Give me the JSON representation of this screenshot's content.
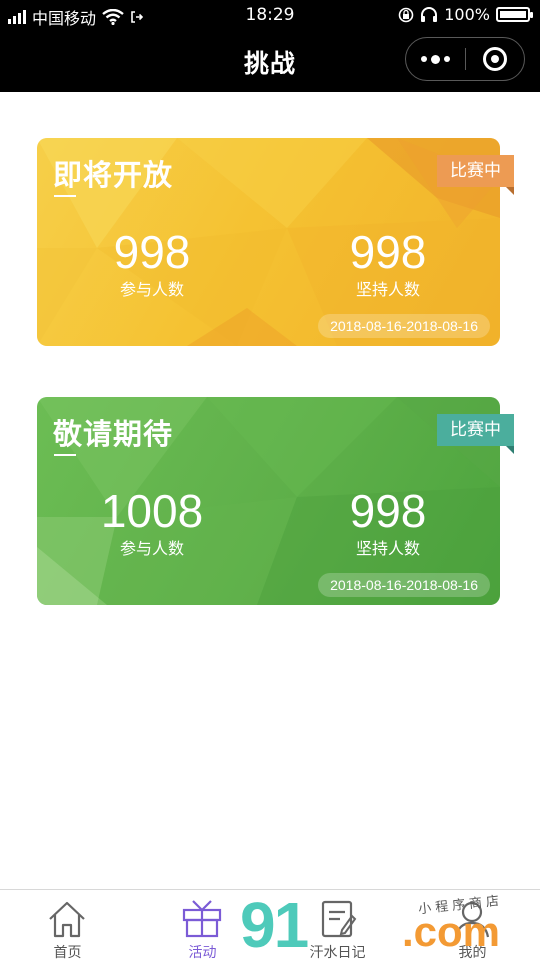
{
  "status_bar": {
    "carrier": "中国移动",
    "time": "18:29",
    "battery": "100%"
  },
  "nav": {
    "title": "挑战"
  },
  "cards": [
    {
      "name": "即将开放",
      "badge": "比赛中",
      "participants": "998",
      "participants_label": "参与人数",
      "persisting": "998",
      "persisting_label": "坚持人数",
      "dates": "2018-08-16-2018-08-16",
      "color": "#f5c232",
      "badge_color": "#ed9b53"
    },
    {
      "name": "敬请期待",
      "badge": "比赛中",
      "participants": "1008",
      "participants_label": "参与人数",
      "persisting": "998",
      "persisting_label": "坚持人数",
      "dates": "2018-08-16-2018-08-16",
      "color": "#5fb04a",
      "badge_color": "#4bae9d"
    }
  ],
  "tabbar": {
    "items": [
      {
        "label": "首页",
        "icon": "home-icon",
        "active": false
      },
      {
        "label": "活动",
        "icon": "gift-icon",
        "active": true
      },
      {
        "label": "汗水日记",
        "icon": "diary-icon",
        "active": false
      },
      {
        "label": "我的",
        "icon": "user-icon",
        "active": false
      }
    ],
    "active_color": "#7b5bd6"
  },
  "watermark": {
    "big": "91",
    "com": ".com",
    "small": "小程序商店"
  }
}
